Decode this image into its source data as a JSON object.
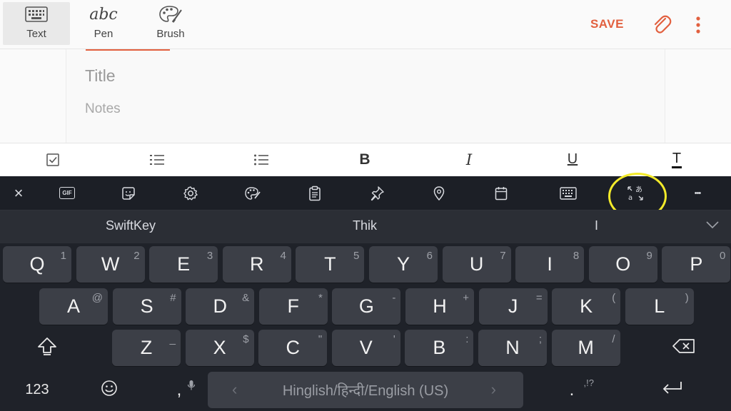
{
  "topbar": {
    "modes": [
      {
        "label": "Text",
        "icon": "keyboard-icon",
        "active": true
      },
      {
        "label": "Pen",
        "icon": "handwriting-icon",
        "glyph": "abc",
        "active": false
      },
      {
        "label": "Brush",
        "icon": "palette-icon",
        "active": false
      }
    ],
    "save_label": "SAVE",
    "accent": "#e2603f"
  },
  "note": {
    "title_placeholder": "Title",
    "notes_placeholder": "Notes"
  },
  "format_bar": [
    "checkbox-icon",
    "numbered-list-icon",
    "bullet-list-icon",
    "bold-icon",
    "italic-icon",
    "underline-icon",
    "text-style-icon"
  ],
  "format_glyphs": {
    "bold": "B",
    "italic": "I",
    "underline": "U",
    "text": "T"
  },
  "keyboard": {
    "toolbar": [
      "close-icon",
      "gif-icon",
      "sticker-icon",
      "settings-icon",
      "theme-icon",
      "clipboard-icon",
      "pin-icon",
      "location-icon",
      "calendar-icon",
      "keyboard-layout-icon",
      "translate-icon",
      "more-icon"
    ],
    "gif_label": "GIF",
    "close_glyph": "×",
    "more_glyph": "•••",
    "suggestions": [
      "SwiftKey",
      "Thik",
      "I"
    ],
    "row1": [
      {
        "k": "Q",
        "s": "1"
      },
      {
        "k": "W",
        "s": "2"
      },
      {
        "k": "E",
        "s": "3"
      },
      {
        "k": "R",
        "s": "4"
      },
      {
        "k": "T",
        "s": "5"
      },
      {
        "k": "Y",
        "s": "6"
      },
      {
        "k": "U",
        "s": "7"
      },
      {
        "k": "I",
        "s": "8"
      },
      {
        "k": "O",
        "s": "9"
      },
      {
        "k": "P",
        "s": "0"
      }
    ],
    "row2": [
      {
        "k": "A",
        "s": "@"
      },
      {
        "k": "S",
        "s": "#"
      },
      {
        "k": "D",
        "s": "&"
      },
      {
        "k": "F",
        "s": "*"
      },
      {
        "k": "G",
        "s": "-"
      },
      {
        "k": "H",
        "s": "+"
      },
      {
        "k": "J",
        "s": "="
      },
      {
        "k": "K",
        "s": "("
      },
      {
        "k": "L",
        "s": ")"
      }
    ],
    "row3": [
      {
        "k": "Z",
        "s": "_"
      },
      {
        "k": "X",
        "s": "$"
      },
      {
        "k": "C",
        "s": "\""
      },
      {
        "k": "V",
        "s": "'"
      },
      {
        "k": "B",
        "s": ":"
      },
      {
        "k": "N",
        "s": ";"
      },
      {
        "k": "M",
        "s": "/"
      }
    ],
    "numbers_label": "123",
    "comma": ",",
    "period": ".",
    "period_secondary": ",!?",
    "space_label": "Hinglish/हिन्दी/English (US)",
    "space_left": "‹",
    "space_right": "›"
  }
}
